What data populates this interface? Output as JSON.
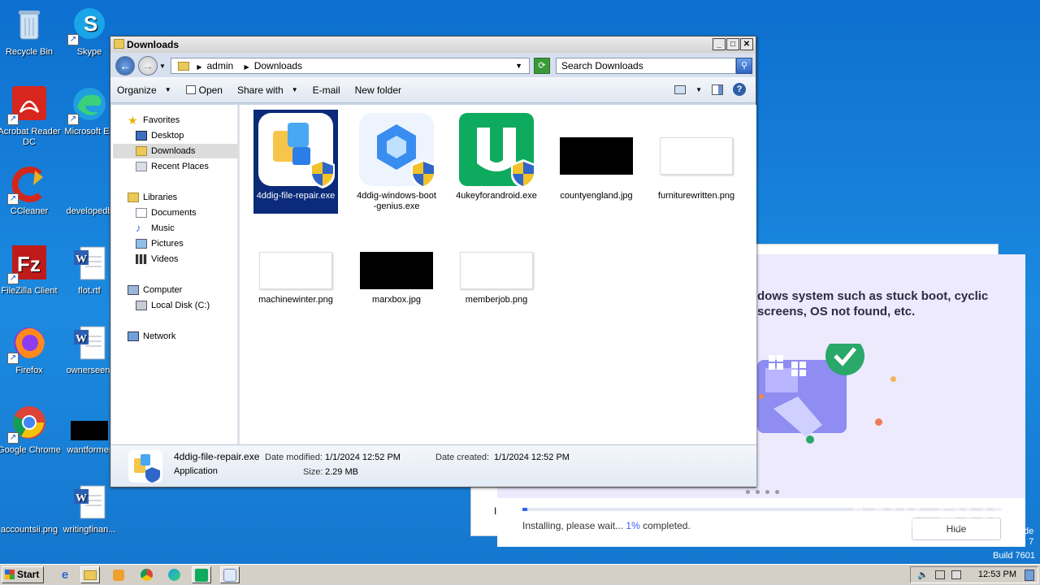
{
  "desktop": {
    "icons": [
      {
        "label": "Recycle Bin"
      },
      {
        "label": "Skype"
      },
      {
        "label": "Acrobat Reader DC"
      },
      {
        "label": "Microsoft Ed"
      },
      {
        "label": "CCleaner"
      },
      {
        "label": "developedb"
      },
      {
        "label": "FileZilla Client"
      },
      {
        "label": "flot.rtf"
      },
      {
        "label": "Firefox"
      },
      {
        "label": "ownerseen."
      },
      {
        "label": "Google Chrome"
      },
      {
        "label": "wantformer"
      },
      {
        "label": "accountsii.png"
      },
      {
        "label": "writingfinan..."
      }
    ]
  },
  "installer": {
    "headline": "dows system such as stuck boot, cyclic screens, OS not found, etc.",
    "status_prefix": "Installing, please wait... ",
    "percent": "1%",
    "status_suffix": " completed.",
    "progress_fraction": 0.01,
    "hide_label": "Hide",
    "fragment_left": "I",
    "side_fragment": "de\n: 7"
  },
  "watermark": "ANY RUN",
  "build_text": "Build 7601",
  "explorer": {
    "title": "Downloads",
    "breadcrumb": [
      "admin",
      "Downloads"
    ],
    "search_placeholder": "Search Downloads",
    "toolbar": {
      "organize": "Organize",
      "open": "Open",
      "share_with": "Share with",
      "email": "E-mail",
      "new_folder": "New folder"
    },
    "nav": {
      "favorites": "Favorites",
      "desktop": "Desktop",
      "downloads": "Downloads",
      "recent": "Recent Places",
      "libraries": "Libraries",
      "documents": "Documents",
      "music": "Music",
      "pictures": "Pictures",
      "videos": "Videos",
      "computer": "Computer",
      "local_disk": "Local Disk (C:)",
      "network": "Network"
    },
    "files": [
      {
        "name": "4ddig-file-repair.exe",
        "selected": true
      },
      {
        "name": "4ddig-windows-boot-genius.exe"
      },
      {
        "name": "4ukeyforandroid.exe"
      },
      {
        "name": "countyengland.jpg"
      },
      {
        "name": "furniturewritten.png"
      },
      {
        "name": "machinewinter.png"
      },
      {
        "name": "marxbox.jpg"
      },
      {
        "name": "memberjob.png"
      }
    ],
    "details": {
      "name": "4ddig-file-repair.exe",
      "type": "Application",
      "date_modified_label": "Date modified:",
      "date_modified": "1/1/2024 12:52 PM",
      "size_label": "Size:",
      "size": "2.29 MB",
      "date_created_label": "Date created:",
      "date_created": "1/1/2024 12:52 PM"
    }
  },
  "taskbar": {
    "start_label": "Start",
    "clock": "12:53 PM"
  }
}
